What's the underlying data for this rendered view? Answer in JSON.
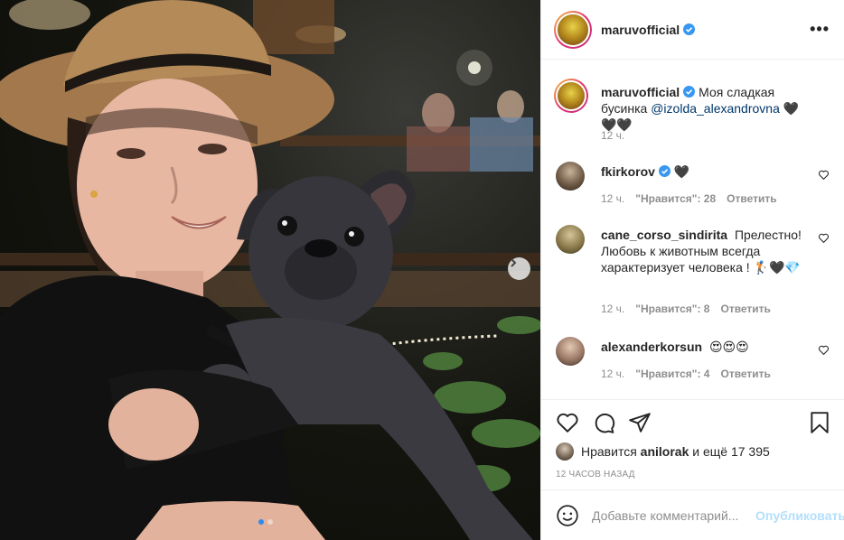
{
  "post": {
    "author": "maruvofficial",
    "verified": true,
    "caption": "Моя сладкая бусинка",
    "caption_mention": "@izolda_alexandrovna",
    "caption_suffix": "🖤🖤🖤",
    "caption_time": "12 ч.",
    "more_label": "•••"
  },
  "comments": [
    {
      "username": "fkirkorov",
      "verified": true,
      "text": "🖤",
      "time": "12 ч.",
      "likes": "\"Нравится\": 28",
      "reply": "Ответить"
    },
    {
      "username": "cane_corso_sindirita",
      "verified": false,
      "text": "Прелестно! Любовь к животным всегда характеризует человека ! 🏌️🖤💎",
      "time": "12 ч.",
      "likes": "\"Нравится\": 8",
      "reply": "Ответить"
    },
    {
      "username": "alexanderkorsun",
      "verified": false,
      "text": "😍😍😍",
      "time": "12 ч.",
      "likes": "\"Нравится\": 4",
      "reply": "Ответить"
    }
  ],
  "likes": {
    "prefix": "Нравится",
    "user": "anilorak",
    "suffix": "и ещё 17 395"
  },
  "timestamp": "12 часов назад",
  "add_comment": {
    "placeholder": "Добавьте комментарий...",
    "post_label": "Опубликовать"
  },
  "carousel": {
    "total": 2,
    "active": 1
  },
  "icons": {
    "like": "heart-icon",
    "comment": "comment-icon",
    "share": "paper-plane-icon",
    "save": "bookmark-icon",
    "emoji": "smiley-icon",
    "next": "chevron-right-icon",
    "verified": "verified-badge-icon"
  },
  "colors": {
    "verified": "#3897f0",
    "link": "#00376b",
    "muted": "#8e8e8e",
    "post_button": "#b2dffc",
    "active_dot": "#2b8cf0"
  }
}
